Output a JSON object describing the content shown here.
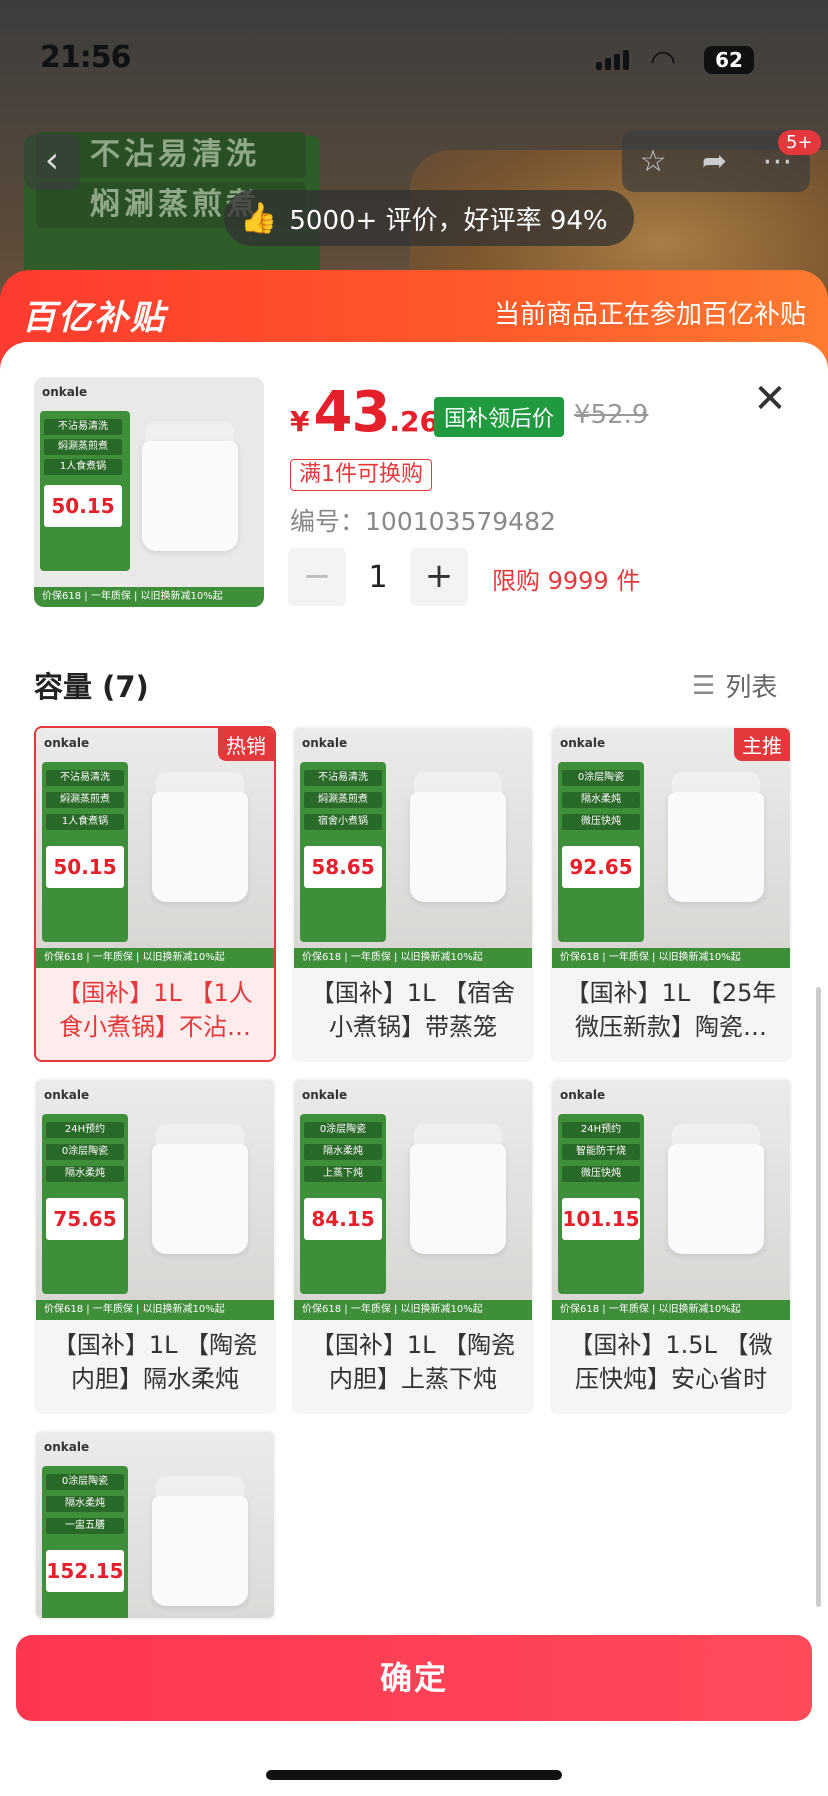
{
  "status_bar": {
    "time": "21:56",
    "battery": "62"
  },
  "background": {
    "tags": [
      "不沾易清洗",
      "焖涮蒸煎煮"
    ],
    "review": "5000+ 评价，好评率 94%",
    "notification_count": "5+"
  },
  "subsidy": {
    "logo": "百亿补贴",
    "text": "当前商品正在参加百亿补贴"
  },
  "product": {
    "yen": "¥",
    "price_int": "43",
    "price_dec": ".26",
    "price_tag": "国补领后价",
    "old_price": "¥52.9",
    "promo": "满1件可换购",
    "code_label": "编号：",
    "code": "100103579482",
    "quantity": "1",
    "limit": "限购 9999 件",
    "thumb_brand": "onkale",
    "thumb_lines": [
      "不沾易清洗",
      "焖涮蒸煎煮",
      "1人食煮锅"
    ],
    "thumb_price": "50.15",
    "thumb_footer": "价保618 | 一年质保 | 以旧换新减10%起"
  },
  "capacity": {
    "title": "容量 (7)",
    "list_label": "列表"
  },
  "variants": [
    {
      "title": "【国补】1L 【1人食小煮锅】不沾…",
      "badge": "热销",
      "price": "50.15",
      "lines": [
        "不沾易清洗",
        "焖涮蒸煎煮",
        "1人食煮锅"
      ],
      "selected": true
    },
    {
      "title": "【国补】1L 【宿舍小煮锅】带蒸笼",
      "badge": "",
      "price": "58.65",
      "lines": [
        "不沾易清洗",
        "焖涮蒸煎煮",
        "宿舍小煮锅"
      ],
      "selected": false
    },
    {
      "title": "【国补】1L 【25年微压新款】陶瓷…",
      "badge": "主推",
      "price": "92.65",
      "lines": [
        "0涂层陶瓷",
        "隔水柔炖",
        "微压快炖"
      ],
      "selected": false
    },
    {
      "title": "【国补】1L 【陶瓷内胆】隔水柔炖",
      "badge": "",
      "price": "75.65",
      "lines": [
        "24H预约",
        "0涂层陶瓷",
        "隔水柔炖"
      ],
      "selected": false
    },
    {
      "title": "【国补】1L 【陶瓷内胆】上蒸下炖",
      "badge": "",
      "price": "84.15",
      "lines": [
        "0涂层陶瓷",
        "隔水柔炖",
        "上蒸下炖"
      ],
      "selected": false
    },
    {
      "title": "【国补】1.5L 【微压快炖】安心省时",
      "badge": "",
      "price": "101.15",
      "lines": [
        "24H预约",
        "智能防干烧",
        "微压快炖"
      ],
      "selected": false
    },
    {
      "title": "",
      "badge": "",
      "price": "152.15",
      "lines": [
        "0涂层陶瓷",
        "隔水柔炖",
        "一盅五膳"
      ],
      "selected": false
    }
  ],
  "confirm": "确定"
}
